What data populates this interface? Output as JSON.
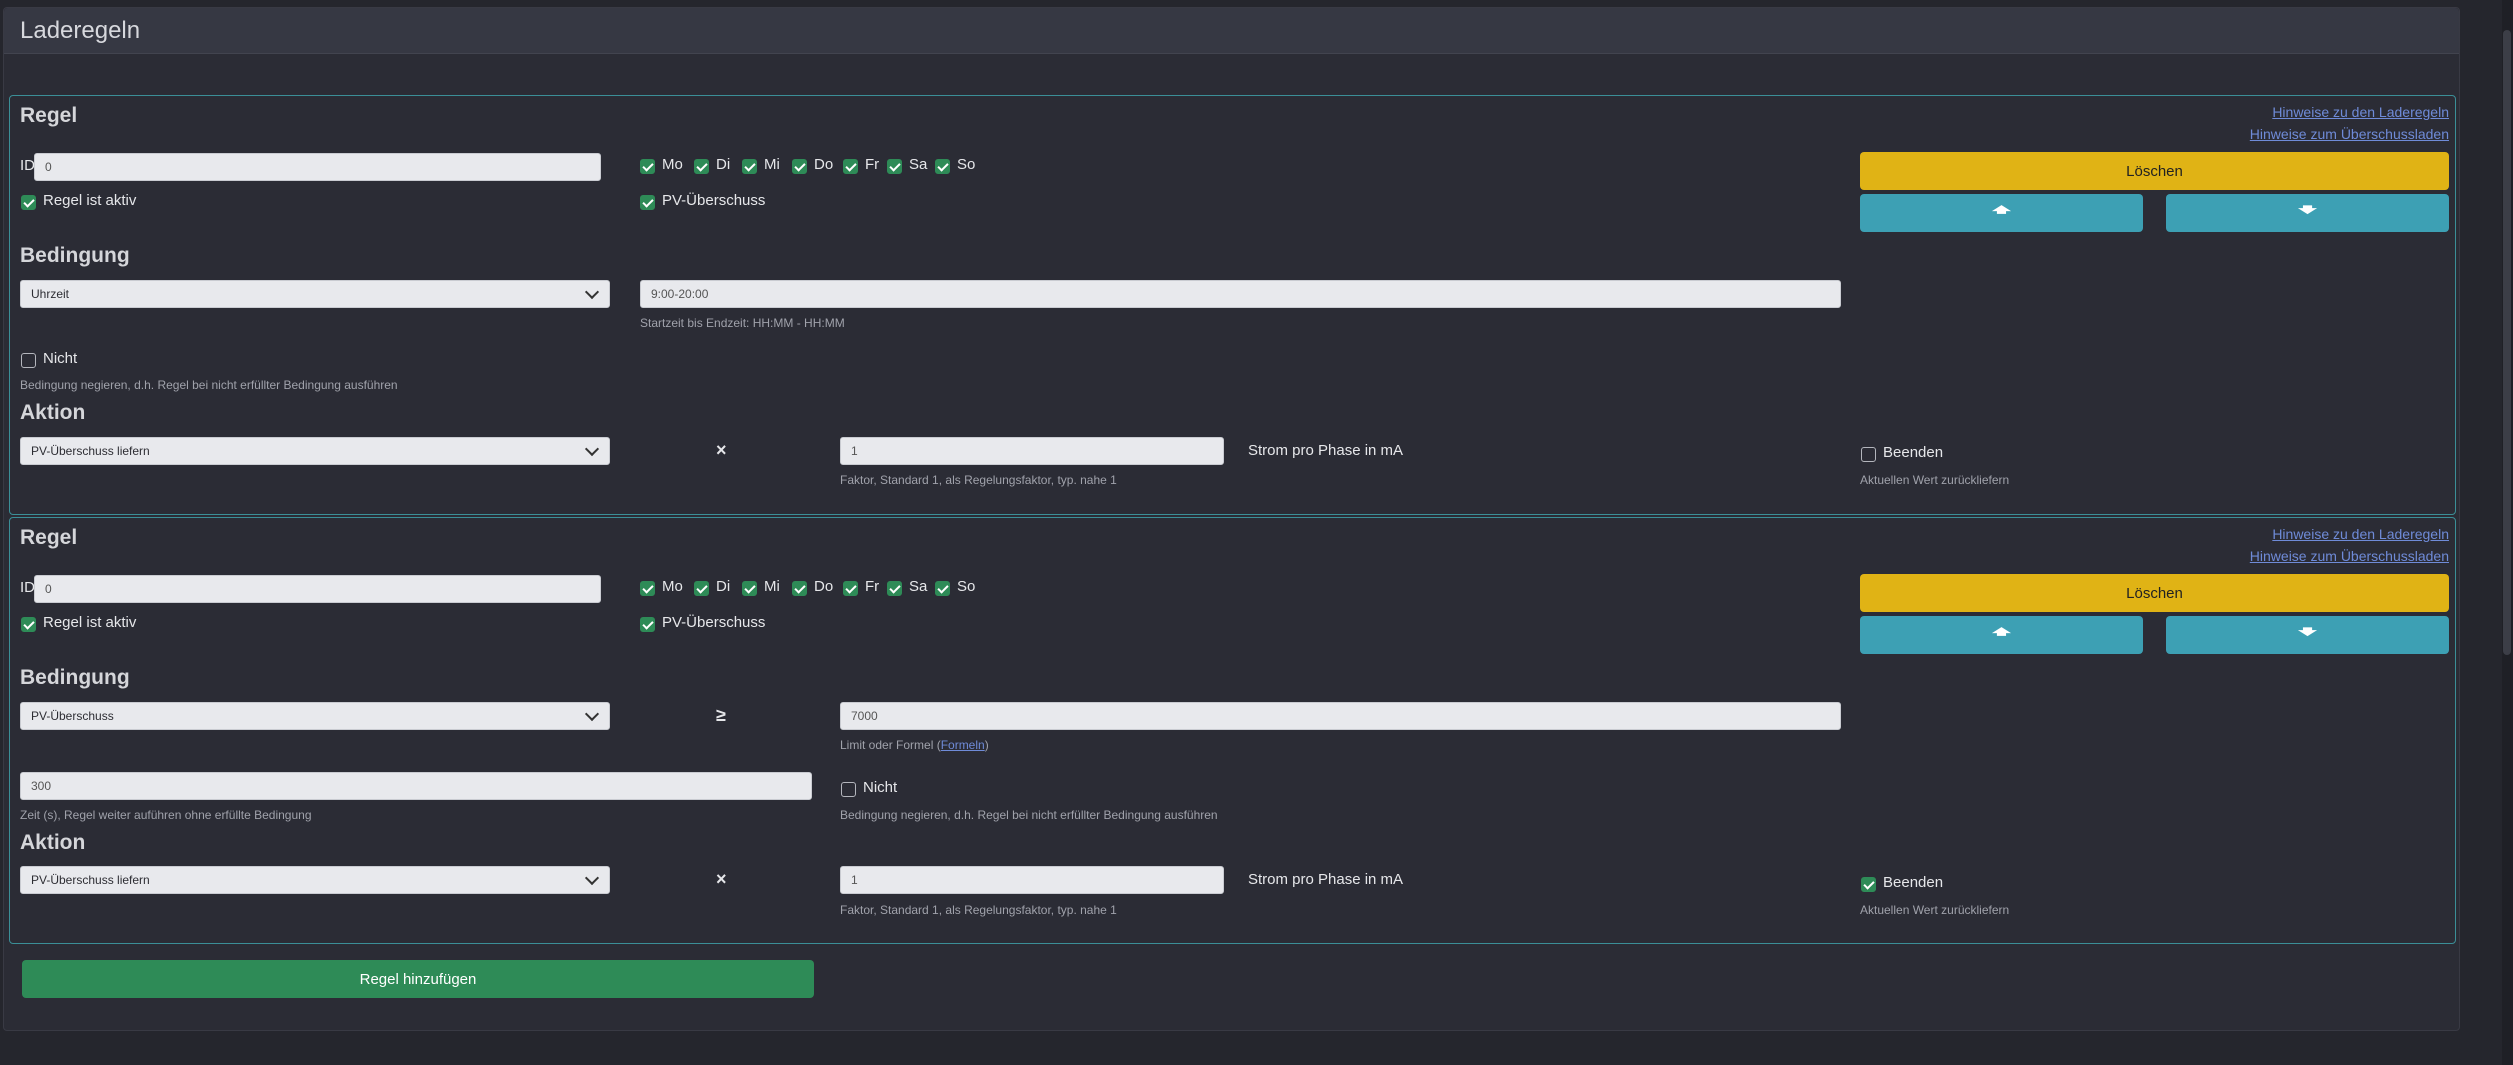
{
  "header": {
    "title": "Laderegeln"
  },
  "rules": [
    {
      "heading": "Regel",
      "links": [
        "Hinweise zu den Laderegeln",
        "Hinweise zum Überschussladen"
      ],
      "id_label": "ID",
      "id_value": "0",
      "days": [
        {
          "label": "Mo",
          "checked": true
        },
        {
          "label": "Di",
          "checked": true
        },
        {
          "label": "Mi",
          "checked": true
        },
        {
          "label": "Do",
          "checked": true
        },
        {
          "label": "Fr",
          "checked": true
        },
        {
          "label": "Sa",
          "checked": true
        },
        {
          "label": "So",
          "checked": true
        }
      ],
      "active_label": "Regel ist aktiv",
      "active_checked": true,
      "pv_label": "PV-Überschuss",
      "pv_checked": true,
      "delete_label": "Löschen",
      "condition_heading": "Bedingung",
      "condition_type": "Uhrzeit",
      "condition_value": "9:00-20:00",
      "condition_help": "Startzeit bis Endzeit: HH:MM - HH:MM",
      "not_label": "Nicht",
      "not_checked": false,
      "not_help": "Bedingung negieren, d.h. Regel bei nicht erfüllter Bedingung ausführen",
      "action_heading": "Aktion",
      "action_type": "PV-Überschuss liefern",
      "action_operator": "×",
      "factor_value": "1",
      "factor_help": "Faktor, Standard 1, als Regelungsfaktor, typ. nahe 1",
      "unit_label": "Strom pro Phase in mA",
      "end_label": "Beenden",
      "end_checked": false,
      "end_help": "Aktuellen Wert zurückliefern"
    },
    {
      "heading": "Regel",
      "links": [
        "Hinweise zu den Laderegeln",
        "Hinweise zum Überschussladen"
      ],
      "id_label": "ID",
      "id_value": "0",
      "days": [
        {
          "label": "Mo",
          "checked": true
        },
        {
          "label": "Di",
          "checked": true
        },
        {
          "label": "Mi",
          "checked": true
        },
        {
          "label": "Do",
          "checked": true
        },
        {
          "label": "Fr",
          "checked": true
        },
        {
          "label": "Sa",
          "checked": true
        },
        {
          "label": "So",
          "checked": true
        }
      ],
      "active_label": "Regel ist aktiv",
      "active_checked": true,
      "pv_label": "PV-Überschuss",
      "pv_checked": true,
      "delete_label": "Löschen",
      "condition_heading": "Bedingung",
      "condition_type": "PV-Überschuss",
      "condition_operator": "≥",
      "condition_value": "7000",
      "condition_help_prefix": "Limit oder Formel (",
      "condition_help_link": "Formeln",
      "condition_help_suffix": ")",
      "time_value": "300",
      "time_help": "Zeit (s), Regel weiter auführen ohne erfüllte Bedingung",
      "not_label": "Nicht",
      "not_checked": false,
      "not_help": "Bedingung negieren, d.h. Regel bei nicht erfüllter Bedingung ausführen",
      "action_heading": "Aktion",
      "action_type": "PV-Überschuss liefern",
      "action_operator": "×",
      "factor_value": "1",
      "factor_help": "Faktor, Standard 1, als Regelungsfaktor, typ. nahe 1",
      "unit_label": "Strom pro Phase in mA",
      "end_label": "Beenden",
      "end_checked": true,
      "end_help": "Aktuellen Wert zurückliefern"
    }
  ],
  "add_rule_label": "Regel hinzufügen",
  "icons": {
    "up": "arrow-up-icon",
    "down": "arrow-down-icon",
    "chevron": "chevron-down-icon"
  },
  "colors": {
    "delete": "#e0b315",
    "arrow": "#3da0b4",
    "add": "#2e8b57",
    "border": "#3b8f97"
  }
}
